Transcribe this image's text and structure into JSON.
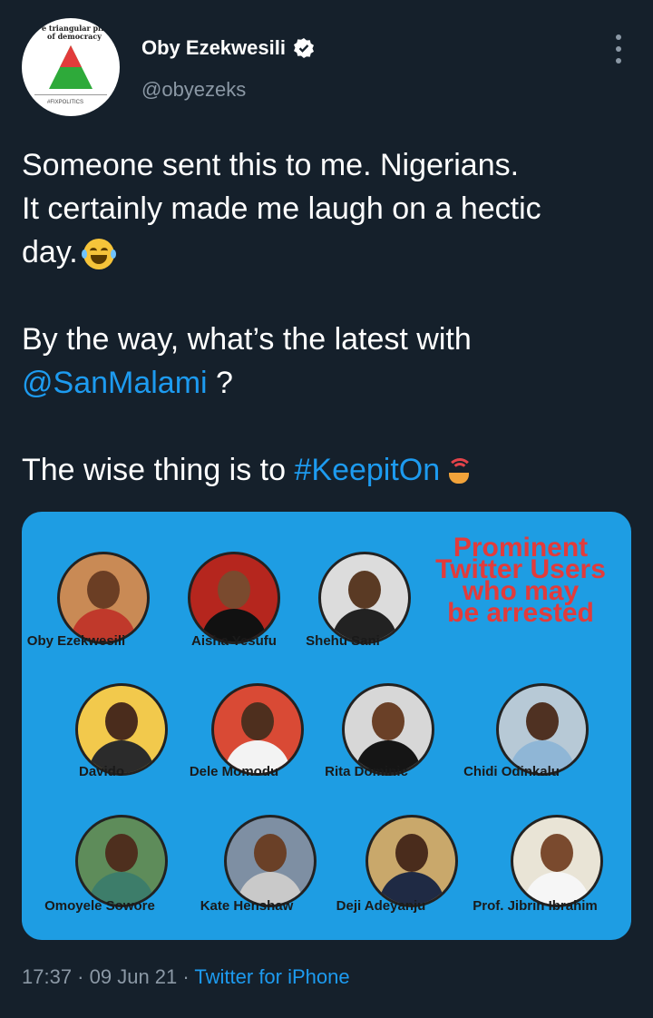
{
  "author": {
    "name": "Oby Ezekwesili",
    "handle": "@obyezeks",
    "verified": true,
    "avatar_text_1": "e triangular pillars",
    "avatar_text_2": "of democracy",
    "avatar_footer": "#FIXPOLITICS"
  },
  "tweet": {
    "line1": "Someone sent this to me. Nigerians.",
    "line2": "It certainly made me laugh on a hectic",
    "line3": "day.",
    "line4": "By the way, what’s the latest with",
    "mention": "@SanMalami",
    "mention_after": " ?",
    "line6_prefix": "The wise thing is to ",
    "hashtag": "#KeepitOn"
  },
  "media": {
    "headline": [
      "Prominent",
      "Twitter Users",
      "who may",
      "be arrested"
    ],
    "people": [
      {
        "name": "Oby Ezekwesili",
        "bg": "#c98a55",
        "skin": "#6b3e24",
        "shirt": "#c0392b"
      },
      {
        "name": "Aisha Yesufu",
        "bg": "#b5261e",
        "skin": "#7a4a2e",
        "shirt": "#111111"
      },
      {
        "name": "Shehu Sani",
        "bg": "#dcdcdc",
        "skin": "#5a3a24",
        "shirt": "#222222"
      },
      {
        "name": "Davido",
        "bg": "#f2c94c",
        "skin": "#4a2c1c",
        "shirt": "#2b2b2b"
      },
      {
        "name": "Dele Momodu",
        "bg": "#d94a35",
        "skin": "#4e2f1e",
        "shirt": "#f3f3f3"
      },
      {
        "name": "Rita Dominic",
        "bg": "#d7d7d7",
        "skin": "#6a4027",
        "shirt": "#151515"
      },
      {
        "name": "Chidi Odinkalu",
        "bg": "#b7c9d6",
        "skin": "#4f3122",
        "shirt": "#8fb6d6"
      },
      {
        "name": "Omoyele Sowore",
        "bg": "#5e8c5a",
        "skin": "#4e2f1e",
        "shirt": "#3d7d6a"
      },
      {
        "name": "Kate Henshaw",
        "bg": "#7e8fa3",
        "skin": "#6a4027",
        "shirt": "#c9c9c9"
      },
      {
        "name": "Deji Adeyanju",
        "bg": "#c9a86b",
        "skin": "#4a2c1c",
        "shirt": "#1f2a44"
      },
      {
        "name": "Prof. Jibrin Ibrahim",
        "bg": "#e9e4d6",
        "skin": "#7a4a2e",
        "shirt": "#f6f6f6"
      }
    ]
  },
  "meta": {
    "time": "17:37",
    "date": "09 Jun 21",
    "separator": " · ",
    "source": "Twitter for iPhone"
  },
  "icons": {
    "verified": "verified-badge-icon",
    "more": "more-vertical-icon",
    "emoji": "face-with-tears-of-joy-icon",
    "keepiton": "signal-hands-icon"
  },
  "colors": {
    "background": "#15202b",
    "link": "#1d9bf0",
    "muted": "#8b98a5",
    "card": "#1e9de3",
    "headline": "#e23b3b"
  }
}
